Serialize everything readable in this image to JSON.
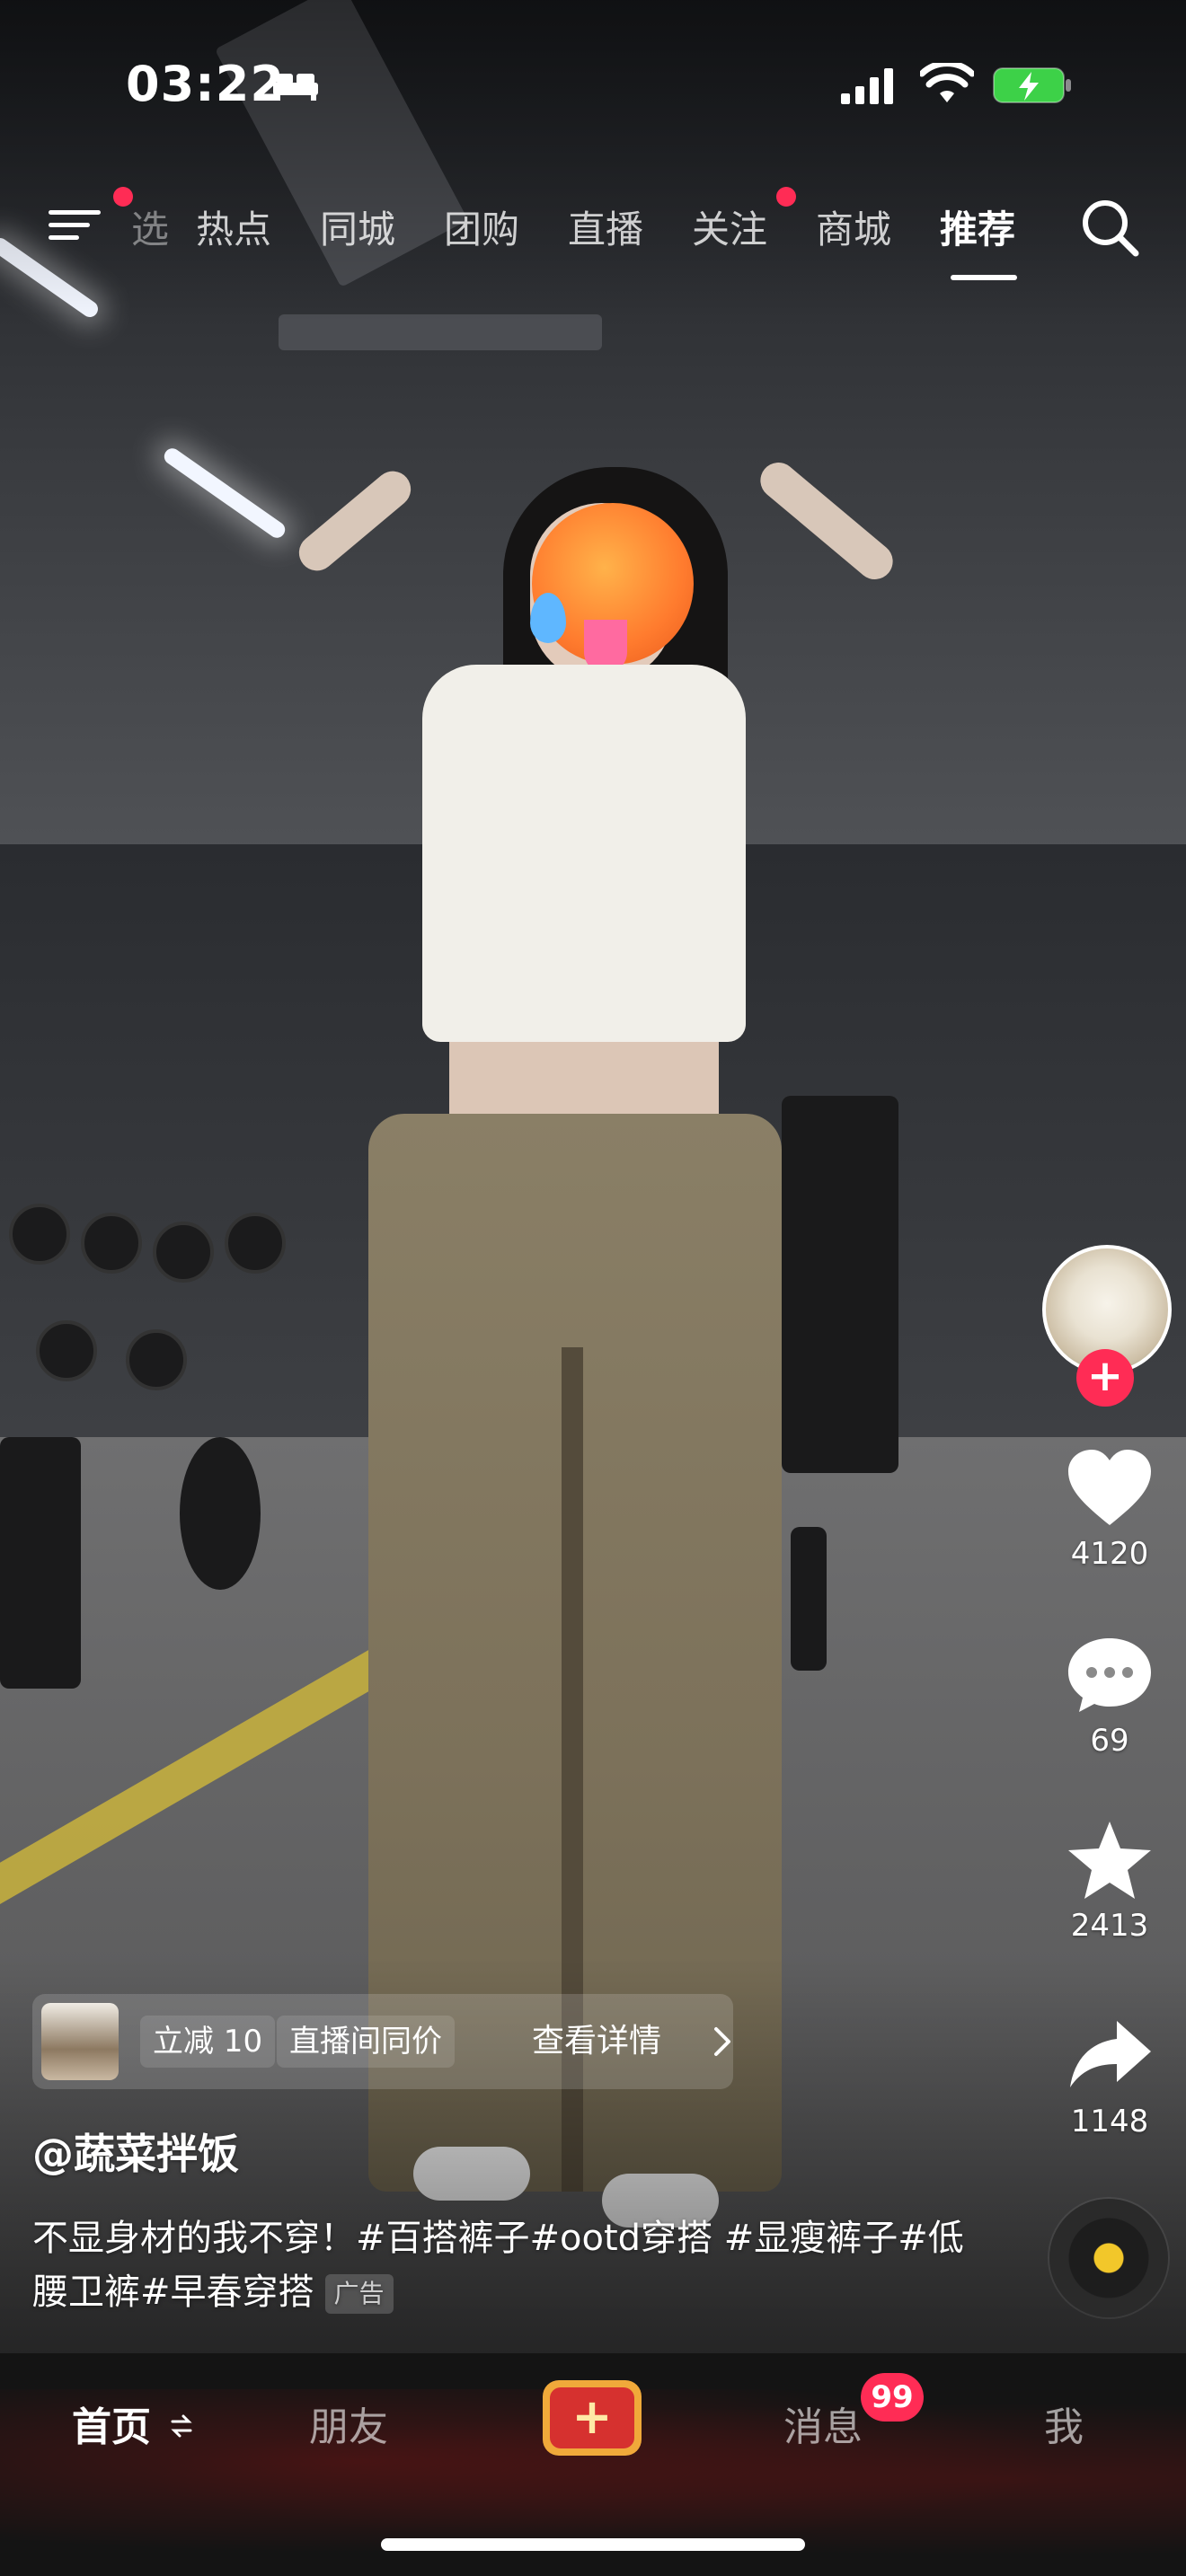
{
  "status_bar": {
    "time": "03:22",
    "icons": [
      "sleep-icon",
      "signal-icon",
      "wifi-icon",
      "battery-charging-icon"
    ]
  },
  "top_nav": {
    "tabs": [
      {
        "label": "选",
        "active": false
      },
      {
        "label": "热点",
        "active": false
      },
      {
        "label": "同城",
        "active": false
      },
      {
        "label": "团购",
        "active": false
      },
      {
        "label": "直播",
        "active": false
      },
      {
        "label": "关注",
        "active": false,
        "dot": true
      },
      {
        "label": "商城",
        "active": false
      },
      {
        "label": "推荐",
        "active": true
      }
    ],
    "menu_icon": "menu-icon",
    "search_icon": "search-icon"
  },
  "actions": {
    "like_count": "4120",
    "comment_count": "69",
    "favorite_count": "2413",
    "share_count": "1148"
  },
  "promo": {
    "tag1": "立减 10",
    "tag2": "直播间同价",
    "detail": "查看详情"
  },
  "post": {
    "author": "@蔬菜拌饭",
    "caption": "不显身材的我不穿！#百搭裤子#ootd穿搭 #显瘦裤子#低腰卫裤#早春穿搭",
    "ad_label": "广告"
  },
  "bottom_tabs": {
    "home": "首页",
    "friends": "朋友",
    "create": "+",
    "messages": "消息",
    "messages_badge": "99",
    "me": "我"
  },
  "colors": {
    "accent_red": "#ff2c55",
    "create_orange": "#f0a93a",
    "tab_bar": "#141414"
  }
}
